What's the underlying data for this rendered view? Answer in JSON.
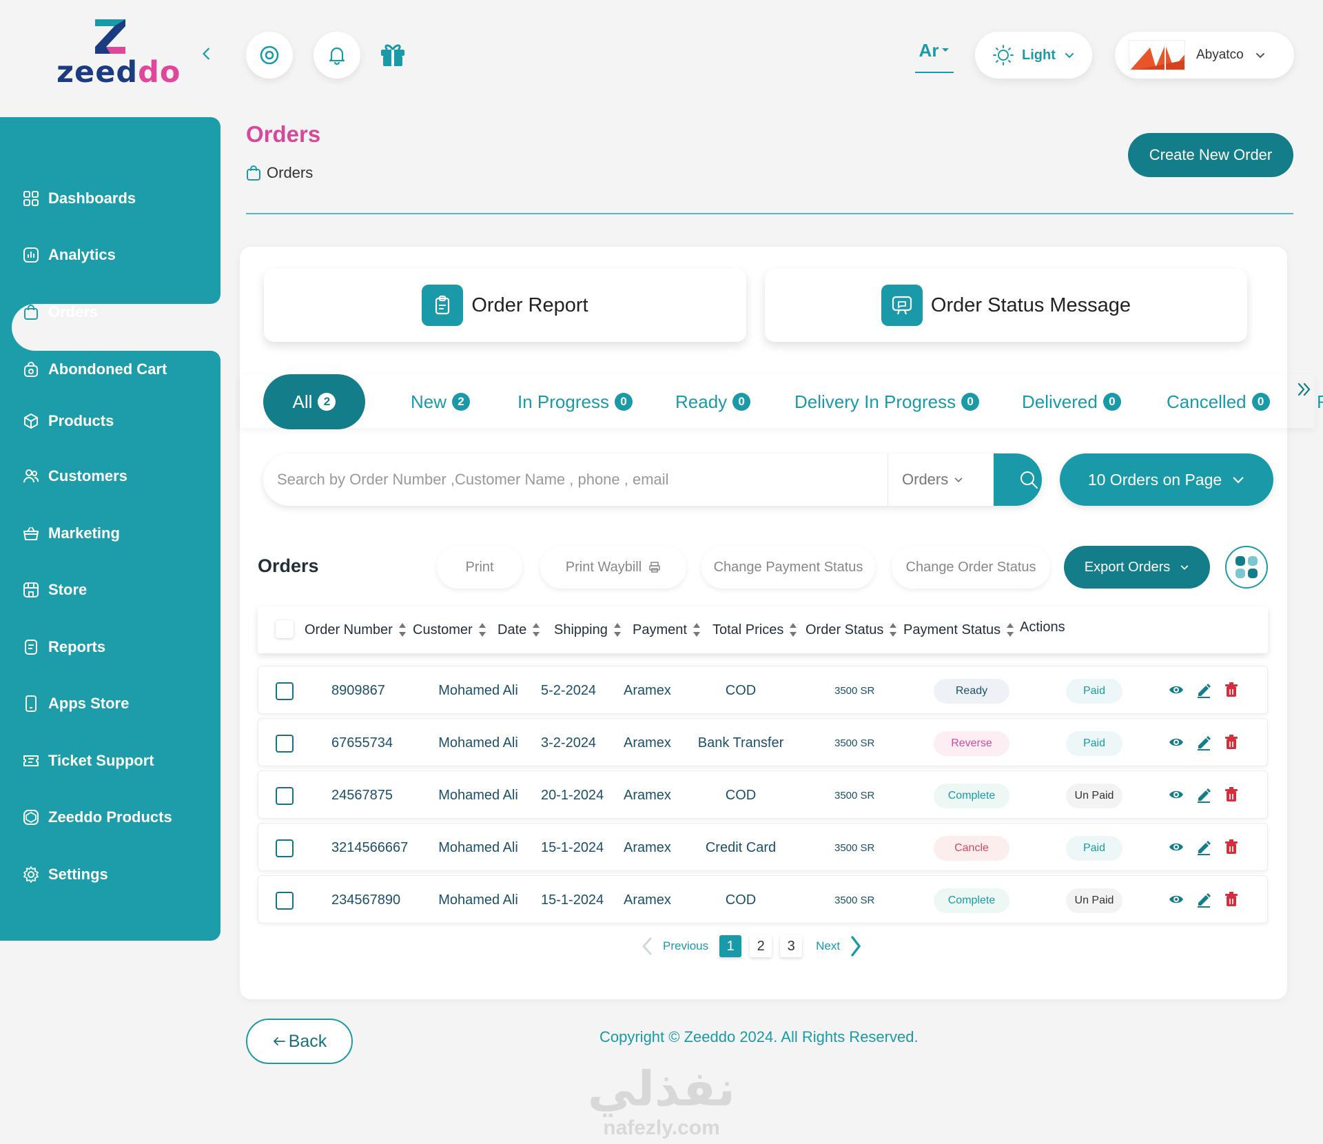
{
  "brand": {
    "name_start": "zeed",
    "name_end": "do"
  },
  "topbar": {
    "lang": "Ar",
    "theme": "Light",
    "user": "Abyatco"
  },
  "sidebar": {
    "items": [
      {
        "label": "Dashboards",
        "icon": "grid-icon"
      },
      {
        "label": "Analytics",
        "icon": "chart-icon"
      },
      {
        "label": "Orders",
        "icon": "bag-icon"
      },
      {
        "label": "Abondoned Cart",
        "icon": "cart-icon"
      },
      {
        "label": "Products",
        "icon": "box-icon"
      },
      {
        "label": "Customers",
        "icon": "users-icon"
      },
      {
        "label": "Marketing",
        "icon": "basket-icon"
      },
      {
        "label": "Store",
        "icon": "store-icon"
      },
      {
        "label": "Reports",
        "icon": "report-icon"
      },
      {
        "label": "Apps Store",
        "icon": "phone-icon"
      },
      {
        "label": "Ticket Support",
        "icon": "ticket-icon"
      },
      {
        "label": "Zeeddo Products",
        "icon": "zeeddo-icon"
      },
      {
        "label": "Settings",
        "icon": "gear-icon"
      }
    ]
  },
  "header": {
    "title": "Orders",
    "breadcrumb": "Orders",
    "create_label": "Create New Order"
  },
  "cards": {
    "report": "Order Report",
    "status_msg": "Order Status Message"
  },
  "tabs": [
    {
      "label": "All",
      "count": "2"
    },
    {
      "label": "New",
      "count": "2"
    },
    {
      "label": "In Progress",
      "count": "0"
    },
    {
      "label": "Ready",
      "count": "0"
    },
    {
      "label": "Delivery In Progress",
      "count": "0"
    },
    {
      "label": "Delivered",
      "count": "0"
    },
    {
      "label": "Cancelled",
      "count": "0"
    },
    {
      "label": "R",
      "count": ""
    }
  ],
  "search": {
    "placeholder": "Search by Order Number ,Customer Name , phone , email",
    "scope": "Orders",
    "per_page": "10 Orders on Page"
  },
  "toolbar": {
    "title": "Orders",
    "print": "Print",
    "print_waybill": "Print Waybill",
    "change_payment": "Change Payment Status",
    "change_order": "Change Order Status",
    "export": "Export Orders"
  },
  "table": {
    "columns": [
      "Order Number",
      "Customer",
      "Date",
      "Shipping",
      "Payment",
      "Total Prices",
      "Order Status",
      "Payment Status",
      "Actions"
    ],
    "rows": [
      {
        "number": "8909867",
        "customer": "Mohamed Ali",
        "date": "5-2-2024",
        "shipping": "Aramex",
        "payment": "COD",
        "total": "3500 SR",
        "order_status": "Ready",
        "payment_status": "Paid"
      },
      {
        "number": "67655734",
        "customer": "Mohamed Ali",
        "date": "3-2-2024",
        "shipping": "Aramex",
        "payment": "Bank Transfer",
        "total": "3500 SR",
        "order_status": "Reverse",
        "payment_status": "Paid"
      },
      {
        "number": "24567875",
        "customer": "Mohamed Ali",
        "date": "20-1-2024",
        "shipping": "Aramex",
        "payment": "COD",
        "total": "3500 SR",
        "order_status": "Complete",
        "payment_status": "Un Paid"
      },
      {
        "number": "3214566667",
        "customer": "Mohamed Ali",
        "date": "15-1-2024",
        "shipping": "Aramex",
        "payment": "Credit Card",
        "total": "3500 SR",
        "order_status": "Cancle",
        "payment_status": "Paid"
      },
      {
        "number": "234567890",
        "customer": "Mohamed Ali",
        "date": "15-1-2024",
        "shipping": "Aramex",
        "payment": "COD",
        "total": "3500 SR",
        "order_status": "Complete",
        "payment_status": "Un Paid"
      }
    ]
  },
  "pagination": {
    "previous": "Previous",
    "next": "Next",
    "pages": [
      "1",
      "2",
      "3"
    ],
    "current": "1"
  },
  "footer": {
    "back": "Back",
    "copyright": "Copyright © Zeeddo 2024. All Rights Reserved.",
    "watermark_ar": "نفذلي",
    "watermark_en": "nafezly.com"
  },
  "colors": {
    "primary": "#1a9aa8",
    "primary_dark": "#137d8a",
    "accent": "#d8489a"
  }
}
